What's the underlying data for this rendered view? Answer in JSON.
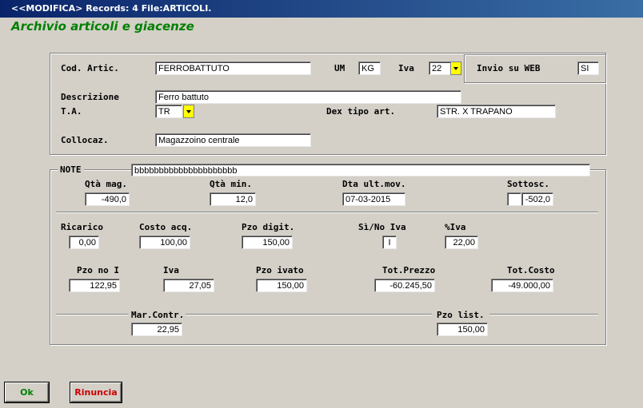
{
  "window": {
    "title": "<<MODIFICA> Records: 4  File:ARTICOLI."
  },
  "heading": "Archivio articoli e giacenze",
  "top": {
    "cod_artic_label": "Cod. Artic.",
    "cod_artic_value": "FERROBATTUTO",
    "um_label": "UM",
    "um_value": "KG",
    "iva_label": "Iva",
    "iva_value": "22",
    "invio_web_label": "Invio su WEB",
    "invio_web_value": "SI",
    "descrizione_label": "Descrizione",
    "descrizione_value": "Ferro battuto",
    "ta_label": "T.A.",
    "ta_value": "TR",
    "dex_tipo_label": "Dex tipo art.",
    "dex_tipo_value": "STR. X TRAPANO",
    "collocaz_label": "Collocaz.",
    "collocaz_value": "Magazzoino centrale"
  },
  "note": {
    "label": "NOTE",
    "value": "bbbbbbbbbbbbbbbbbbbbb",
    "qta_mag_label": "Qtà mag.",
    "qta_mag_value": "-490,0",
    "qta_min_label": "Qtà min.",
    "qta_min_value": "12,0",
    "dta_ult_label": "Dta ult.mov.",
    "dta_ult_value": "07-03-2015",
    "sottosc_label": "Sottosc.",
    "sottosc_flag": "",
    "sottosc_value": "-502,0",
    "ricarico_label": "Ricarico",
    "ricarico_value": "0,00",
    "costo_acq_label": "Costo acq.",
    "costo_acq_value": "100,00",
    "pzo_digit_label": "Pzo digit.",
    "pzo_digit_value": "150,00",
    "si_no_iva_label": "Sì/No Iva",
    "si_no_iva_value": "I",
    "perc_iva_label": "%Iva",
    "perc_iva_value": "22,00",
    "pzo_no_i_label": "Pzo no I",
    "pzo_no_i_value": "122,95",
    "iva_label": "Iva",
    "iva_value": "27,05",
    "pzo_ivato_label": "Pzo ivato",
    "pzo_ivato_value": "150,00",
    "tot_prezzo_label": "Tot.Prezzo",
    "tot_prezzo_value": "-60.245,50",
    "tot_costo_label": "Tot.Costo",
    "tot_costo_value": "-49.000,00",
    "mar_contr_label": "Mar.Contr.",
    "mar_contr_value": "22,95",
    "pzo_list_label": "Pzo list.",
    "pzo_list_value": "150,00"
  },
  "buttons": {
    "ok_label": "Ok",
    "ok_color": "#008000",
    "rinuncia_label": "Rinuncia",
    "rinuncia_color": "#cc0000"
  }
}
